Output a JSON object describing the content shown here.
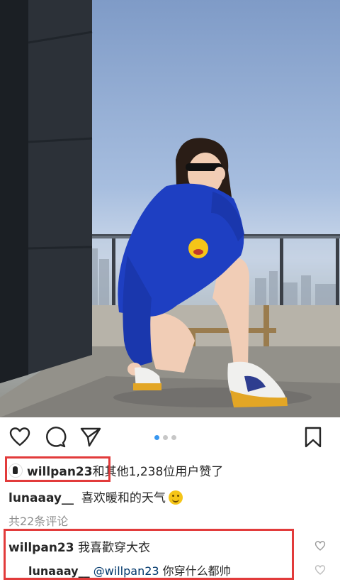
{
  "post": {
    "likes": {
      "username": "willpan23",
      "connector": "和",
      "rest": "其他1,238位用户赞了"
    },
    "caption": {
      "username": "lunaaay__",
      "text": "喜欢暖和的天气"
    },
    "view_all_comments": "共22条评论",
    "comments": [
      {
        "username": "willpan23",
        "text": "我喜歡穿大衣"
      },
      {
        "username": "lunaaay__",
        "mention": "@willpan23",
        "text": "你穿什么都帅"
      }
    ],
    "carousel": {
      "current": 1,
      "total": 3
    }
  },
  "icons": {
    "like": "heart-icon",
    "comment": "comment-icon",
    "share": "send-icon",
    "save": "bookmark-icon"
  },
  "colors": {
    "highlight": "#e23b3b",
    "carousel_active": "#3897f0",
    "hoodie": "#1e3fc2"
  }
}
